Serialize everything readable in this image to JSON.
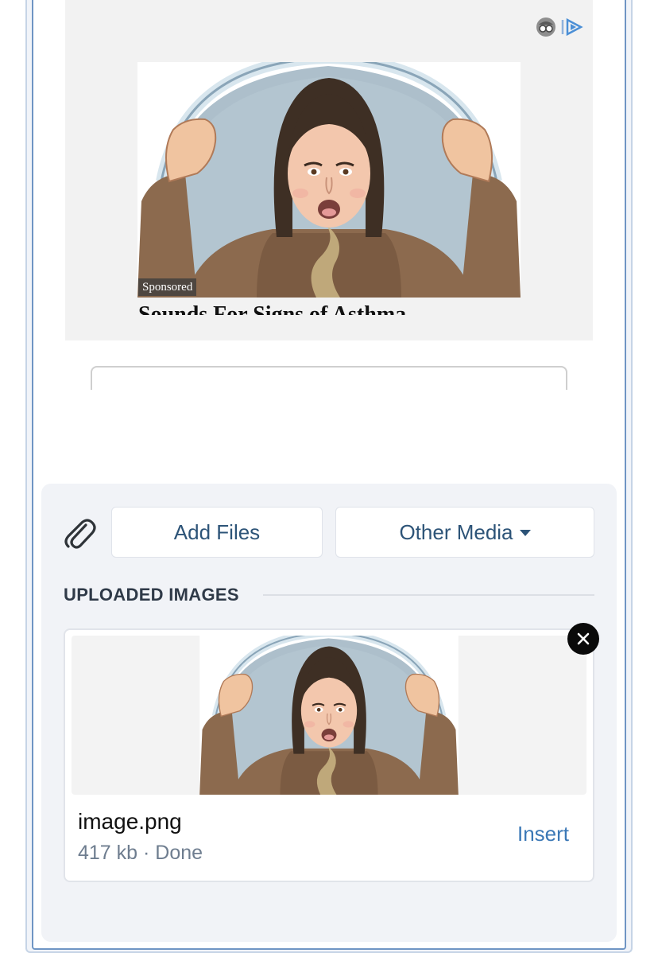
{
  "ad": {
    "sponsored_label": "Sponsored",
    "headline": "Sounds For Signs of Asthma",
    "choices_icon": "ad-choices-icon",
    "image_icon": "illustration-woman-under-dome"
  },
  "media": {
    "attach_icon": "paperclip-icon",
    "add_files_label": "Add Files",
    "other_media_label": "Other Media",
    "other_media_icon": "caret-down-icon"
  },
  "uploads": {
    "section_title": "UPLOADED IMAGES",
    "items": [
      {
        "file_name": "image.png",
        "meta": "417 kb · Done",
        "insert_label": "Insert",
        "remove_icon": "close-icon"
      }
    ]
  },
  "colors": {
    "accent": "#3b78b6",
    "button_text": "#2d5478",
    "frame_border": "#6f95c4",
    "panel_bg": "#f1f3f7"
  }
}
